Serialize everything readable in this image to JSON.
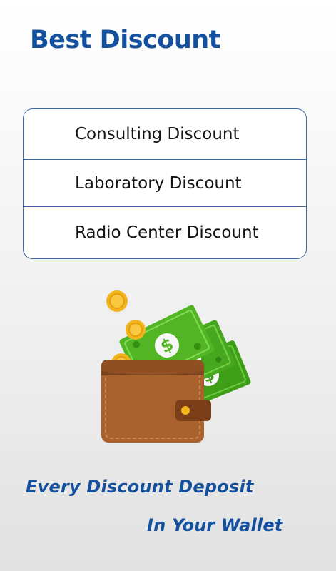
{
  "header": {
    "title": "Best Discount"
  },
  "menu": {
    "items": [
      {
        "label": "Consulting Discount"
      },
      {
        "label": "Laboratory Discount"
      },
      {
        "label": "Radio Center Discount"
      }
    ]
  },
  "illustration": {
    "icon": "wallet-with-money-icon",
    "colors": {
      "wallet": "#a9612d",
      "cash": "#4caf1f",
      "coin": "#f3b51c"
    }
  },
  "tagline": {
    "line1": "Every Discount Deposit",
    "line2": "In Your Wallet"
  },
  "theme": {
    "accent": "#13509e",
    "border": "#3e67a6"
  }
}
